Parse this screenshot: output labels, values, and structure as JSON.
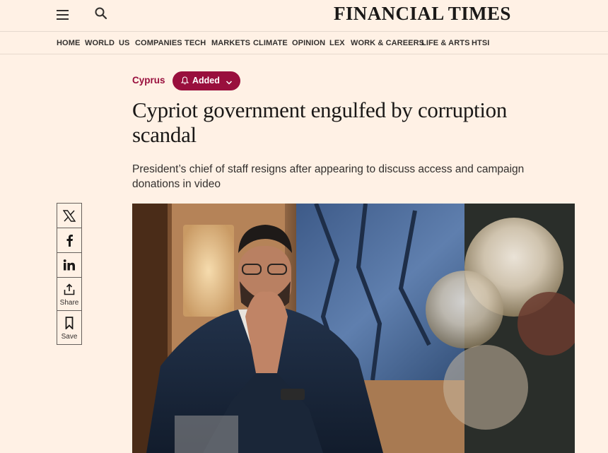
{
  "header": {
    "logo": "FINANCIAL TIMES",
    "menu_icon": "hamburger-menu-icon",
    "search_icon": "search-icon"
  },
  "nav": {
    "items": [
      "HOME",
      "WORLD",
      "US",
      "COMPANIES",
      "TECH",
      "MARKETS",
      "CLIMATE",
      "OPINION",
      "LEX",
      "WORK & CAREERS",
      "LIFE & ARTS",
      "HTSI"
    ]
  },
  "article": {
    "topic": "Cyprus",
    "follow_label": "Added",
    "headline": "Cypriot government engulfed by corruption scandal",
    "standfirst": "President’s chief of staff resigns after appearing to discuss access and campaign donations in video"
  },
  "share": {
    "x_icon": "x-twitter-icon",
    "facebook_icon": "facebook-icon",
    "linkedin_icon": "linkedin-icon",
    "share_label": "Share",
    "save_label": "Save"
  },
  "colors": {
    "background": "#fff1e5",
    "accent": "#990f3d",
    "text": "#33302e"
  }
}
